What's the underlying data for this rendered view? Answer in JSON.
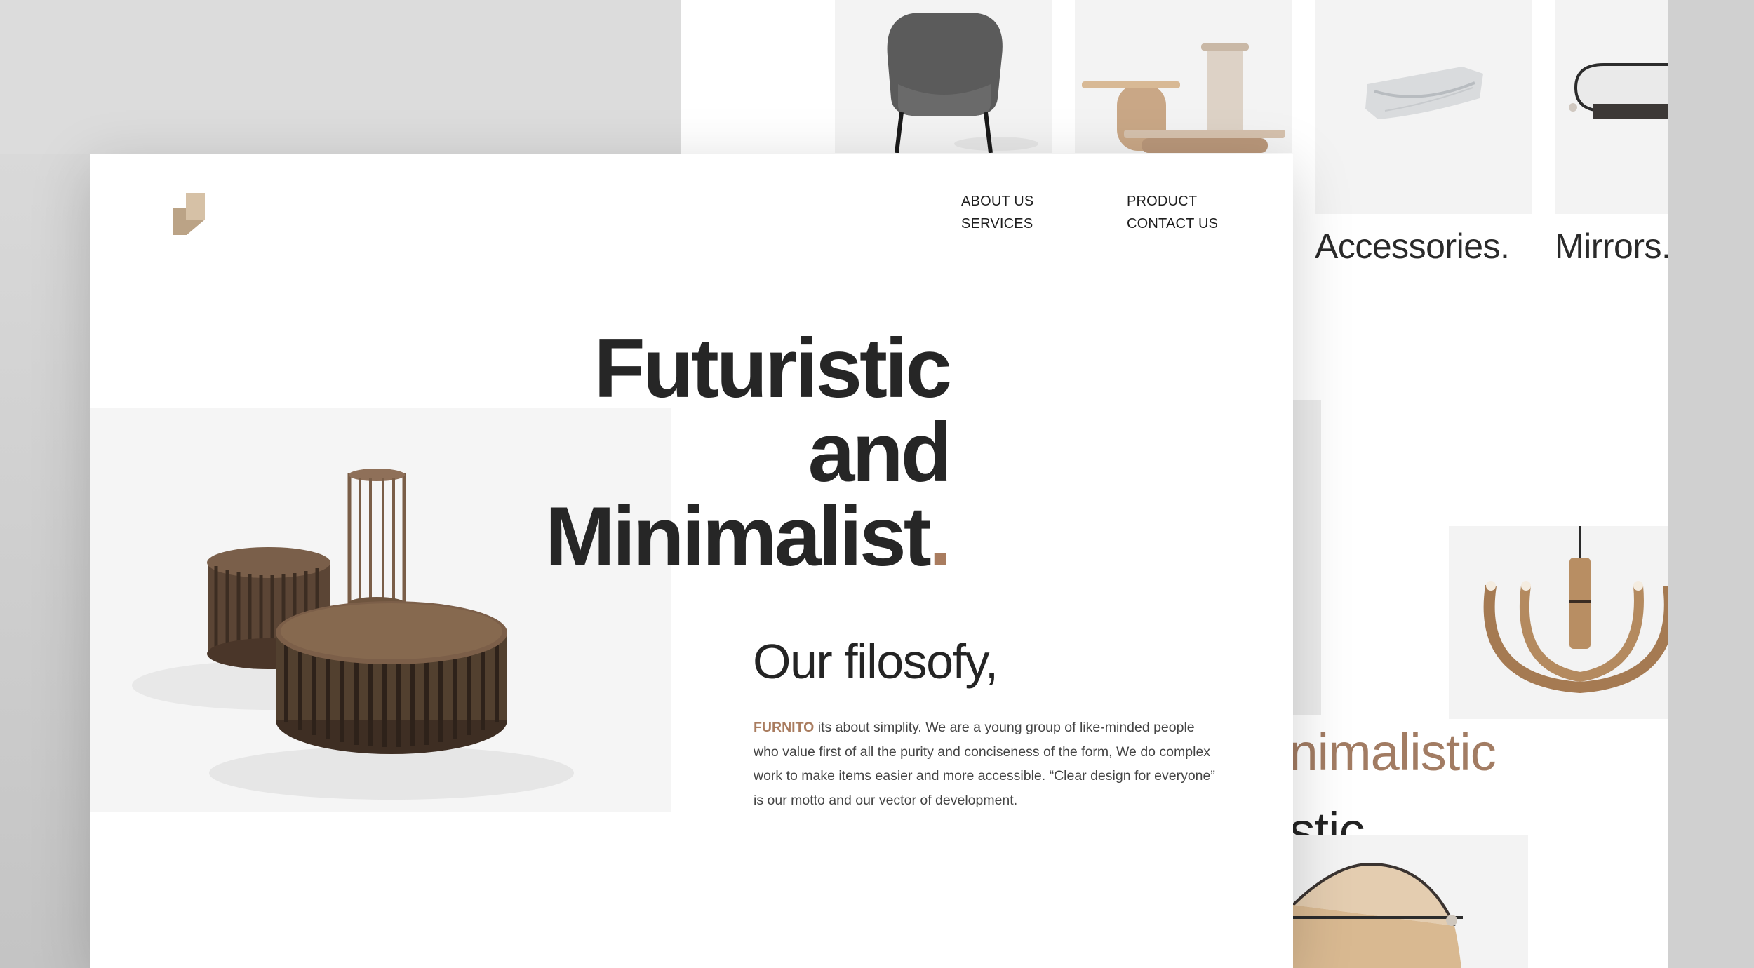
{
  "header": {
    "nav": [
      {
        "label": "ABOUT US"
      },
      {
        "label": "SERVICES"
      },
      {
        "label": "PRODUCT"
      },
      {
        "label": "CONTACT US"
      }
    ]
  },
  "hero": {
    "line1": "Futuristic",
    "line2": "and",
    "line3": "Minimalist",
    "dot": "."
  },
  "philosophy": {
    "title": "Our filosofy,",
    "brand": "FURNITO",
    "body": " its about simplity. We are a young group of like-minded people who value first of all the purity and conciseness of the form, We do complex work to make items easier and more accessible. “Clear design for everyone” is our motto and our vector of development."
  },
  "categories": [
    {
      "label": "Accessories."
    },
    {
      "label": "Mirrors."
    }
  ],
  "peek": {
    "line1": "inimalistic",
    "line2": "istic."
  },
  "colors": {
    "accent": "#a97c5f",
    "text": "#262626",
    "wood": "#6b5342"
  }
}
